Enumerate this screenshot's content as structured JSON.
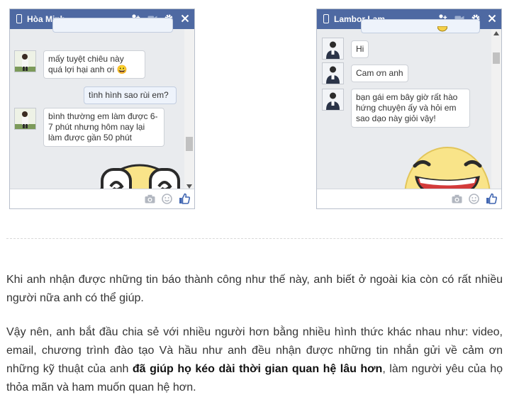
{
  "left_chat": {
    "title": "Hòa Minh",
    "messages": [
      {
        "text": "mấy tuyệt chiêu này quá lợi hại anh ơi 😀"
      },
      {
        "text": "tình hình sao rùi em?"
      },
      {
        "text": "bình thường em làm được 6-7 phút nhưng hôm nay lại làm được gần 50 phút"
      }
    ]
  },
  "right_chat": {
    "title": "Lambor Lam",
    "messages": [
      {
        "text": "Hi"
      },
      {
        "text": "Cam ơn anh"
      },
      {
        "text": "bạn gái em bây giờ rất hào hứng chuyện ấy và hỏi em sao dạo này giỏi vậy!"
      }
    ]
  },
  "article": {
    "p1": "Khi anh nhận được những tin báo thành công như thế này, anh biết ở ngoài kia còn có rất nhiều người nữa anh có thể giúp.",
    "p2_before": "Vậy nên, anh bắt đầu chia sẻ với nhiều người hơn bằng nhiều hình thức khác nhau như: video, email, chương trình đào tạo Và hầu như anh đều nhận được những tin nhắn gửi về cảm ơn những kỹ thuật của anh ",
    "p2_bold": "đã giúp họ kéo dài thời gian quan hệ lâu hơn",
    "p2_after": ", làm người yêu của họ thỏa mãn và ham muốn quan hệ hơn."
  },
  "icons": [
    "mobile-phone-icon",
    "add-friend-icon",
    "video-call-icon",
    "gear-icon",
    "close-icon",
    "camera-icon",
    "sticker-icon",
    "thumbs-up-icon"
  ],
  "colors": {
    "header": "#4e69a2",
    "like": "#4267b2"
  }
}
